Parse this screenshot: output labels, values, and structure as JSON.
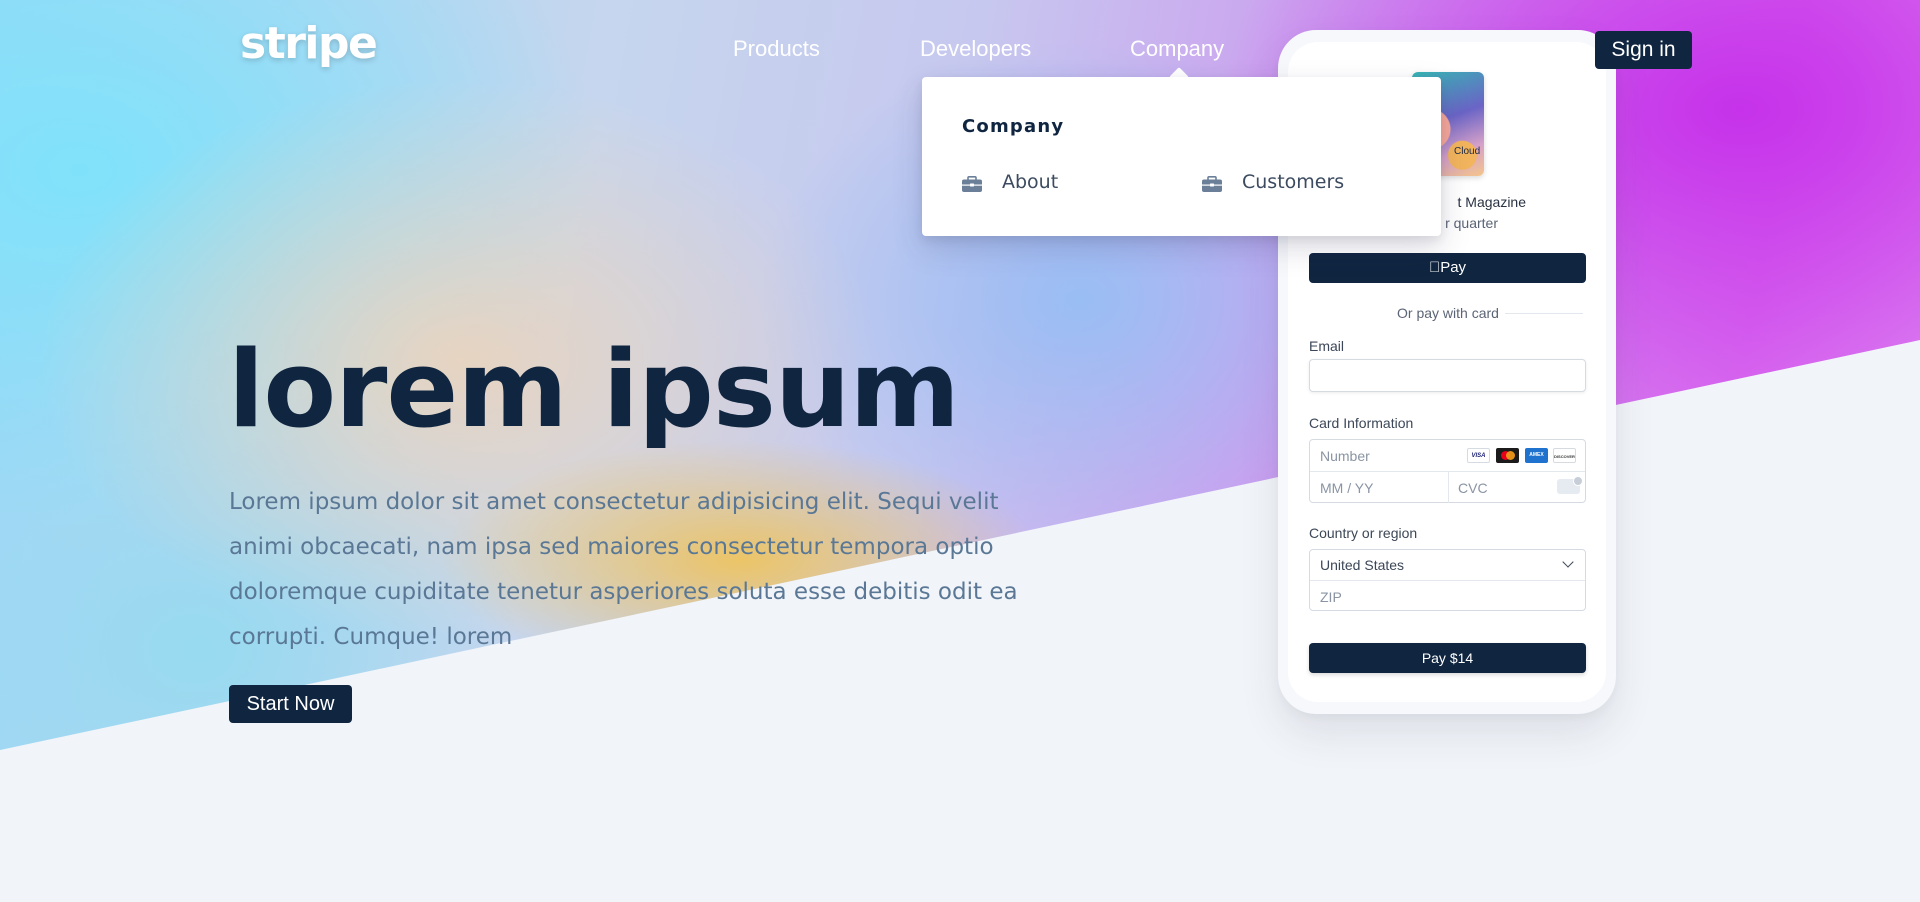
{
  "header": {
    "logo": "stripe",
    "nav": [
      "Products",
      "Developers",
      "Company"
    ],
    "signin_label": "Sign in"
  },
  "hero": {
    "title": "lorem ipsum",
    "subtitle": "Lorem ipsum dolor sit amet consectetur adipisicing elit. Sequi velit animi obcaecati, nam ipsa sed maiores consectetur tempora optio doloremque cupiditate tenetur asperiores soluta esse debitis odit ea corrupti. Cumque! lorem",
    "cta_label": "Start Now"
  },
  "dropdown": {
    "title": "Company",
    "items": [
      {
        "label": "About",
        "icon": "briefcase-icon"
      },
      {
        "label": "Customers",
        "icon": "briefcase-icon"
      }
    ]
  },
  "checkout": {
    "product_card_label": "Cloud",
    "product_title": "t Magazine",
    "product_price": "r quarter",
    "apple_pay_label": "Pay",
    "or_text": "Or pay with card",
    "email_label": "Email",
    "email_value": "",
    "card_label": "Card Information",
    "card_number_placeholder": "Number",
    "card_expiry_placeholder": "MM / YY",
    "card_cvc_placeholder": "CVC",
    "card_brands": [
      "VISA",
      "Mastercard",
      "AMEX",
      "DISCOVER"
    ],
    "country_label": "Country or region",
    "country_value": "United States",
    "zip_placeholder": "ZIP",
    "pay_label": "Pay $14"
  },
  "colors": {
    "navy": "#0f2540",
    "page_bg": "#f1f4f8",
    "subtitle_text": "#5a7896",
    "gradient_magenta": "#c632ea",
    "gradient_cyan": "#80e2fa",
    "gradient_gold": "#eec460"
  }
}
